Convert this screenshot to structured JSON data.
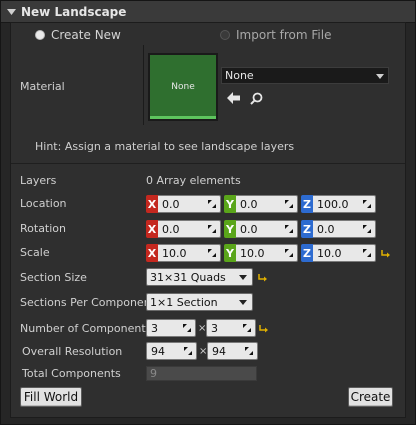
{
  "panel": {
    "title": "New Landscape"
  },
  "mode": {
    "create_new": "Create New",
    "import_from_file": "Import from File",
    "selected": "create_new"
  },
  "material": {
    "label": "Material",
    "thumbnail_text": "None",
    "combo_value": "None",
    "use_selected_icon": "arrow-left-icon",
    "browse_icon": "search-icon"
  },
  "hint": "Hint: Assign a material to see landscape layers",
  "layers": {
    "label": "Layers",
    "value": "0 Array elements"
  },
  "location": {
    "label": "Location",
    "x": "0.0",
    "y": "0.0",
    "z": "100.0"
  },
  "rotation": {
    "label": "Rotation",
    "x": "0.0",
    "y": "0.0",
    "z": "0.0"
  },
  "scale": {
    "label": "Scale",
    "x": "10.0",
    "y": "10.0",
    "z": "10.0"
  },
  "axis": {
    "x": "X",
    "y": "Y",
    "z": "Z"
  },
  "section_size": {
    "label": "Section Size",
    "value": "31×31 Quads"
  },
  "sections_per_component": {
    "label": "Sections Per Componen",
    "value": "1×1 Section"
  },
  "number_of_components": {
    "label": "Number of Components",
    "x": "3",
    "y": "3"
  },
  "overall_resolution": {
    "label": "Overall Resolution",
    "x": "94",
    "y": "94"
  },
  "total_components": {
    "label": "Total Components",
    "value": "9"
  },
  "times_symbol": "×",
  "buttons": {
    "fill_world": "Fill World",
    "create": "Create"
  },
  "colors": {
    "axis_x": "#c4281f",
    "axis_y": "#5aa51a",
    "axis_z": "#2d6bd0",
    "reset_arrow": "#e0b000",
    "thumbnail": "#2f6f2f"
  }
}
